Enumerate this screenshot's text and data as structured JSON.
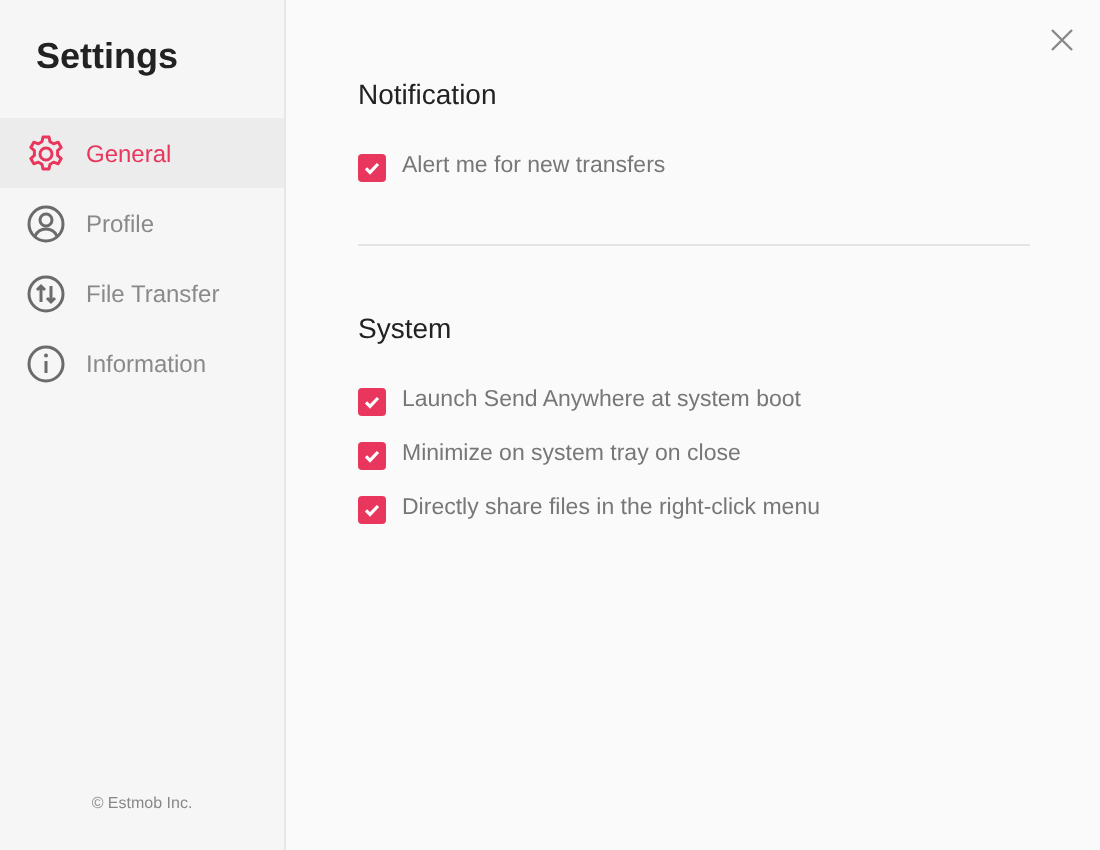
{
  "sidebar": {
    "title": "Settings",
    "items": [
      {
        "label": "General",
        "kind": "gear",
        "selected": true
      },
      {
        "label": "Profile",
        "kind": "person",
        "selected": false
      },
      {
        "label": "File Transfer",
        "kind": "transfer",
        "selected": false
      },
      {
        "label": "Information",
        "kind": "info",
        "selected": false
      }
    ],
    "footer": "© Estmob Inc."
  },
  "sections": [
    {
      "title": "Notification",
      "options": [
        {
          "label": "Alert me for new transfers",
          "checked": true
        }
      ]
    },
    {
      "title": "System",
      "options": [
        {
          "label": "Launch Send Anywhere at system boot",
          "checked": true
        },
        {
          "label": "Minimize on system tray on close",
          "checked": true
        },
        {
          "label": "Directly share files in the right-click menu",
          "checked": true
        }
      ]
    }
  ]
}
